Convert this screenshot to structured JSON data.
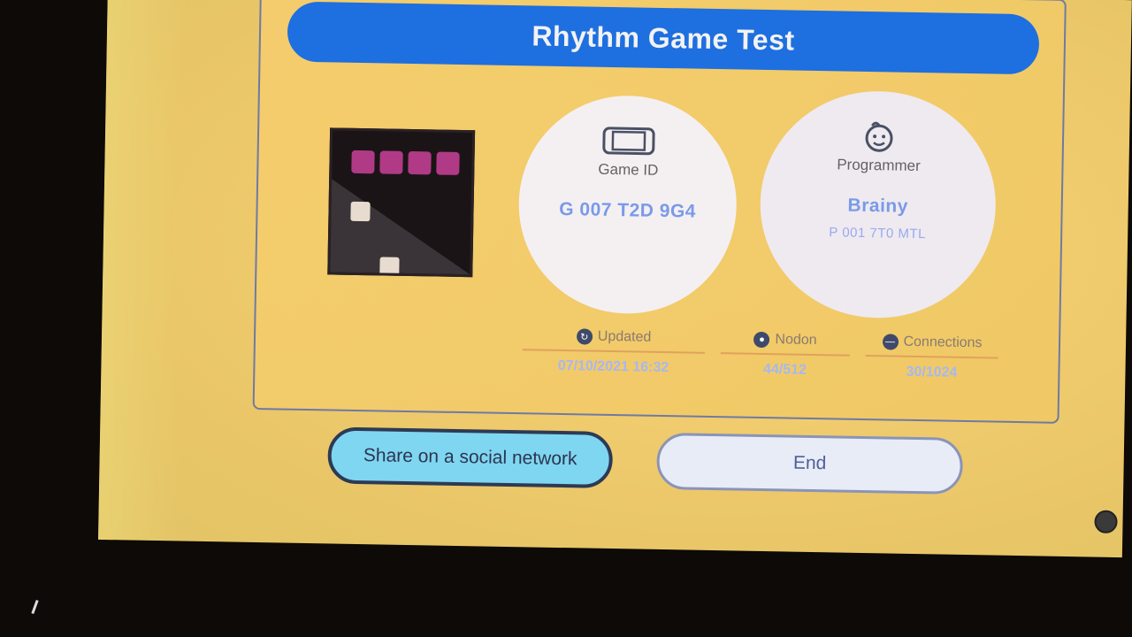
{
  "title": "Rhythm Game Test",
  "game_id": {
    "label": "Game ID",
    "value": "G 007 T2D 9G4"
  },
  "programmer": {
    "label": "Programmer",
    "name": "Brainy",
    "id": "P 001 7T0 MTL"
  },
  "stats": [
    {
      "label": "Updated",
      "value": "07/10/2021 16:32",
      "icon": "refresh-icon"
    },
    {
      "label": "Nodon",
      "value": "44/512",
      "icon": "lock-icon"
    },
    {
      "label": "Connections",
      "value": "30/1024",
      "icon": "minus-circle-icon"
    }
  ],
  "buttons": {
    "share": "Share on a social network",
    "end": "End"
  },
  "colors": {
    "title_bar": "#1e6fe0",
    "background": "#f0cc6e",
    "share_button": "#7fd6f0",
    "value_text": "#7a9ae8"
  }
}
